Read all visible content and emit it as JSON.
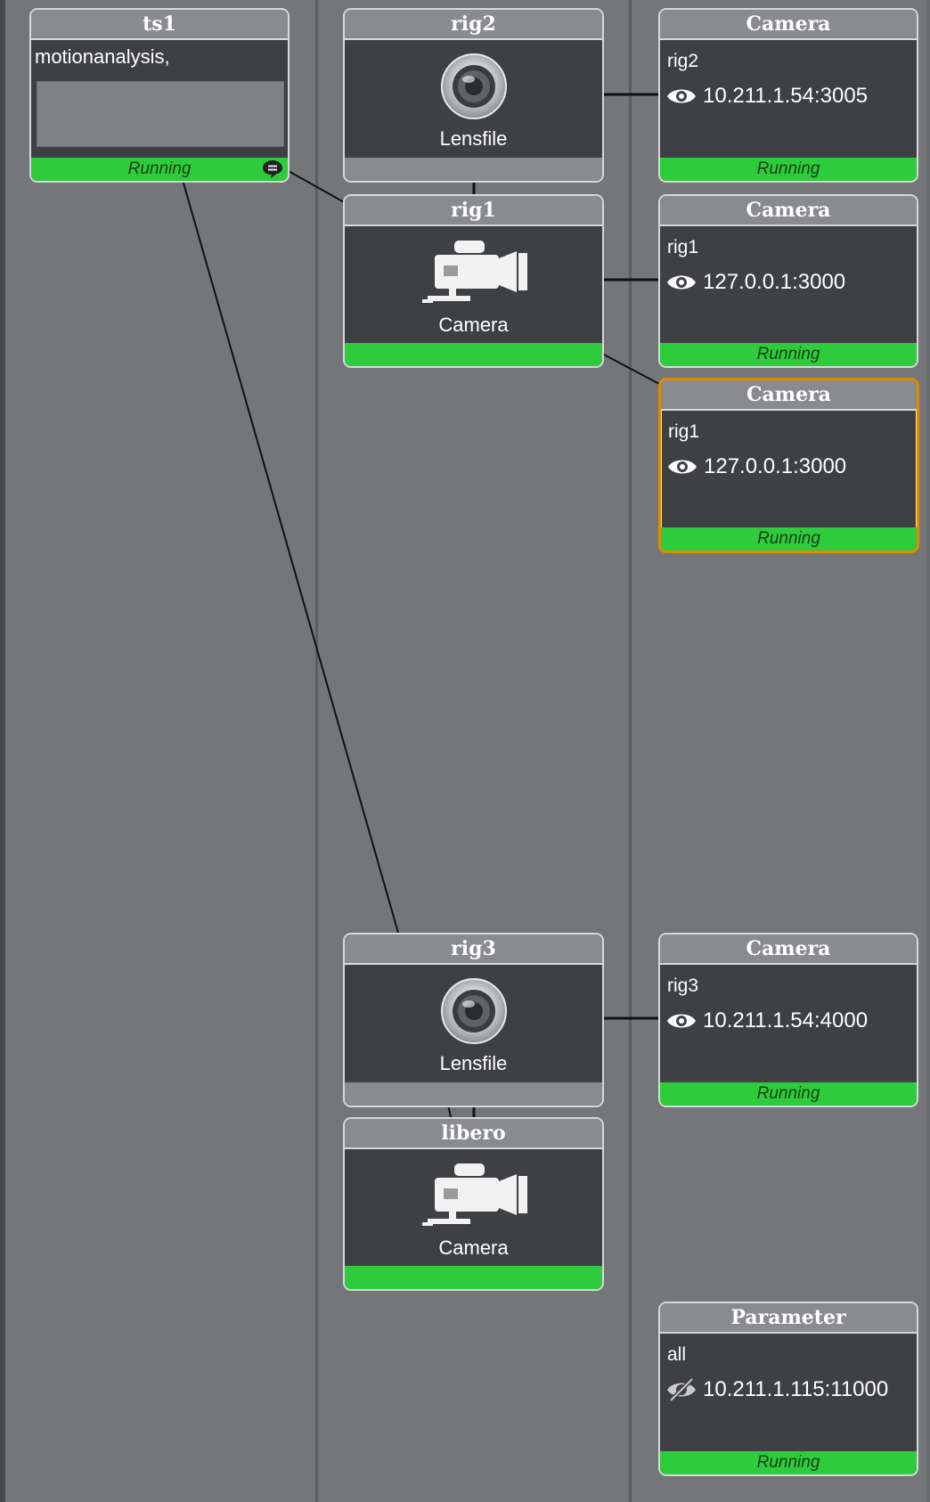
{
  "nodes": {
    "ts1": {
      "title": "ts1",
      "text": "motionanalysis,",
      "status": "Running",
      "icon": "chat-bubble-icon"
    },
    "rig2": {
      "title": "rig2",
      "caption": "Lensfile",
      "icon": "lens-icon"
    },
    "rig1": {
      "title": "rig1",
      "caption": "Camera",
      "icon": "video-camera-icon"
    },
    "rig3": {
      "title": "rig3",
      "caption": "Lensfile",
      "icon": "lens-icon"
    },
    "libero": {
      "title": "libero",
      "caption": "Camera",
      "icon": "video-camera-icon"
    },
    "cam_rig2": {
      "title": "Camera",
      "subtitle": "rig2",
      "address": "10.211.1.54:3005",
      "status": "Running",
      "icon": "eye-icon"
    },
    "cam_rig1_a": {
      "title": "Camera",
      "subtitle": "rig1",
      "address": "127.0.0.1:3000",
      "status": "Running",
      "icon": "eye-icon"
    },
    "cam_rig1_b": {
      "title": "Camera",
      "subtitle": "rig1",
      "address": "127.0.0.1:3000",
      "status": "Running",
      "icon": "eye-icon",
      "selected": true
    },
    "cam_rig3": {
      "title": "Camera",
      "subtitle": "rig3",
      "address": "10.211.1.54:4000",
      "status": "Running",
      "icon": "eye-icon"
    },
    "parameter": {
      "title": "Parameter",
      "subtitle": "all",
      "address": "10.211.1.115:11000",
      "status": "Running",
      "icon": "eye-hidden-icon"
    }
  },
  "colors": {
    "background": "#75767a",
    "node_body": "#3e4044",
    "node_header": "#8a8b8e",
    "status_running": "#2ecc3c",
    "selected_border": "#e08a00"
  }
}
